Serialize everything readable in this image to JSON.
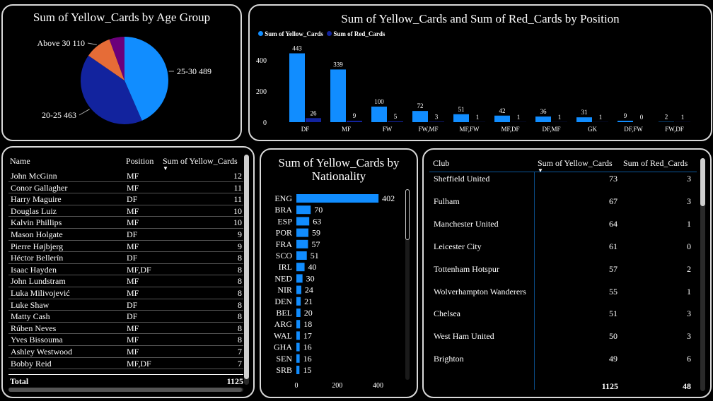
{
  "colors": {
    "yellow_series": "#118DFF",
    "red_series": "#12239E",
    "pie_25_30": "#118DFF",
    "pie_20_25": "#12239E",
    "pie_above_30": "#E66C37",
    "pie_other": "#6B007B"
  },
  "age_pie": {
    "title": "Sum of Yellow_Cards by Age Group",
    "chart_data": {
      "type": "pie",
      "slices": [
        {
          "label": "25-30",
          "value": 489,
          "display": "25-30 489"
        },
        {
          "label": "20-25",
          "value": 463,
          "display": "20-25 463"
        },
        {
          "label": "Above 30",
          "value": 110,
          "display": "Above 30 110"
        },
        {
          "label": "",
          "value": 63
        }
      ]
    }
  },
  "position_bar": {
    "title": "Sum of Yellow_Cards and Sum of Red_Cards by Position",
    "chart_data": {
      "type": "bar",
      "categories": [
        "DF",
        "MF",
        "FW",
        "FW,MF",
        "MF,FW",
        "MF,DF",
        "DF,MF",
        "GK",
        "DF,FW",
        "FW,DF"
      ],
      "series": [
        {
          "name": "Sum of Yellow_Cards",
          "values": [
            443,
            339,
            100,
            72,
            51,
            42,
            36,
            31,
            9,
            2
          ]
        },
        {
          "name": "Sum of Red_Cards",
          "values": [
            26,
            9,
            5,
            3,
            1,
            1,
            1,
            1,
            0,
            1
          ]
        }
      ],
      "yticks": [
        "0",
        "200",
        "400"
      ],
      "ylim": [
        0,
        500
      ],
      "legend": "top-left"
    }
  },
  "player_table": {
    "headers": {
      "name": "Name",
      "position": "Position",
      "yellow": "Sum of Yellow_Cards"
    },
    "rows": [
      {
        "name": "John McGinn",
        "position": "MF",
        "yellow": "12"
      },
      {
        "name": "Conor Gallagher",
        "position": "MF",
        "yellow": "11"
      },
      {
        "name": "Harry Maguire",
        "position": "DF",
        "yellow": "11"
      },
      {
        "name": "Douglas Luiz",
        "position": "MF",
        "yellow": "10"
      },
      {
        "name": "Kalvin Phillips",
        "position": "MF",
        "yellow": "10"
      },
      {
        "name": "Mason Holgate",
        "position": "DF",
        "yellow": "9"
      },
      {
        "name": "Pierre Højbjerg",
        "position": "MF",
        "yellow": "9"
      },
      {
        "name": "Héctor Bellerín",
        "position": "DF",
        "yellow": "8"
      },
      {
        "name": "Isaac Hayden",
        "position": "MF,DF",
        "yellow": "8"
      },
      {
        "name": "John Lundstram",
        "position": "MF",
        "yellow": "8"
      },
      {
        "name": "Luka Milivojević",
        "position": "MF",
        "yellow": "8"
      },
      {
        "name": "Luke Shaw",
        "position": "DF",
        "yellow": "8"
      },
      {
        "name": "Matty Cash",
        "position": "DF",
        "yellow": "8"
      },
      {
        "name": "Rúben Neves",
        "position": "MF",
        "yellow": "8"
      },
      {
        "name": "Yves Bissouma",
        "position": "MF",
        "yellow": "8"
      },
      {
        "name": "Ashley Westwood",
        "position": "MF",
        "yellow": "7"
      },
      {
        "name": "Bobby Reid",
        "position": "MF,DF",
        "yellow": "7"
      }
    ],
    "total_label": "Total",
    "total_value": "1125"
  },
  "nationality_bar": {
    "title_line1": "Sum of Yellow_Cards by",
    "title_line2": "Nationality",
    "chart_data": {
      "type": "bar",
      "orientation": "horizontal",
      "categories": [
        "ENG",
        "BRA",
        "ESP",
        "POR",
        "FRA",
        "SCO",
        "IRL",
        "NED",
        "NIR",
        "DEN",
        "BEL",
        "ARG",
        "WAL",
        "GHA",
        "SEN",
        "SRB"
      ],
      "values": [
        402,
        70,
        63,
        59,
        57,
        51,
        40,
        30,
        24,
        21,
        20,
        18,
        17,
        16,
        16,
        15
      ],
      "xticks": [
        "0",
        "200",
        "400"
      ],
      "xlim": [
        0,
        450
      ]
    }
  },
  "club_table": {
    "headers": {
      "club": "Club",
      "yellow": "Sum of Yellow_Cards",
      "red": "Sum of Red_Cards"
    },
    "rows": [
      {
        "club": "Sheffield United",
        "yellow": "73",
        "red": "3"
      },
      {
        "club": "Fulham",
        "yellow": "67",
        "red": "3"
      },
      {
        "club": "Manchester United",
        "yellow": "64",
        "red": "1"
      },
      {
        "club": "Leicester City",
        "yellow": "61",
        "red": "0"
      },
      {
        "club": "Tottenham Hotspur",
        "yellow": "57",
        "red": "2"
      },
      {
        "club": "Wolverhampton Wanderers",
        "yellow": "55",
        "red": "1"
      },
      {
        "club": "Chelsea",
        "yellow": "51",
        "red": "3"
      },
      {
        "club": "West Ham United",
        "yellow": "50",
        "red": "3"
      },
      {
        "club": "Brighton",
        "yellow": "49",
        "red": "6"
      }
    ],
    "total_yellow": "1125",
    "total_red": "48"
  }
}
